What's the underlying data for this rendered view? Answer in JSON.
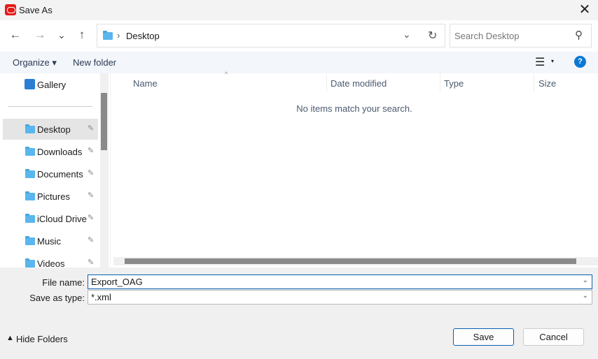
{
  "window": {
    "title": "Save As",
    "close_icon": "close-icon",
    "brand_color": "#e21b1b"
  },
  "nav": {
    "back": "←",
    "forward": "→",
    "recent": "⌄",
    "up": "↑",
    "breadcrumb_sep": "›",
    "location": "Desktop",
    "dropdown": "⌄",
    "refresh": "↻",
    "search_placeholder": "Search Desktop",
    "search_icon": "⚲"
  },
  "toolbar": {
    "organize": "Organize ▾",
    "new_folder": "New folder",
    "view_icon": "☰",
    "view_dropdown": "▾",
    "help": "?"
  },
  "sidebar": {
    "gallery": "Gallery",
    "items": [
      {
        "label": "Desktop",
        "selected": true
      },
      {
        "label": "Downloads"
      },
      {
        "label": "Documents"
      },
      {
        "label": "Pictures"
      },
      {
        "label": "iCloud Drive"
      },
      {
        "label": "Music"
      },
      {
        "label": "Videos"
      }
    ],
    "pin": "📌"
  },
  "columns": [
    "Name",
    "Date modified",
    "Type",
    "Size"
  ],
  "empty_message": "No items match your search.",
  "form": {
    "file_name_label": "File name:",
    "file_name": "Export_OAG",
    "type_label": "Save as type:",
    "type_value": "*.xml"
  },
  "footer": {
    "hide_folders": "Hide Folders",
    "save": "Save",
    "cancel": "Cancel"
  }
}
